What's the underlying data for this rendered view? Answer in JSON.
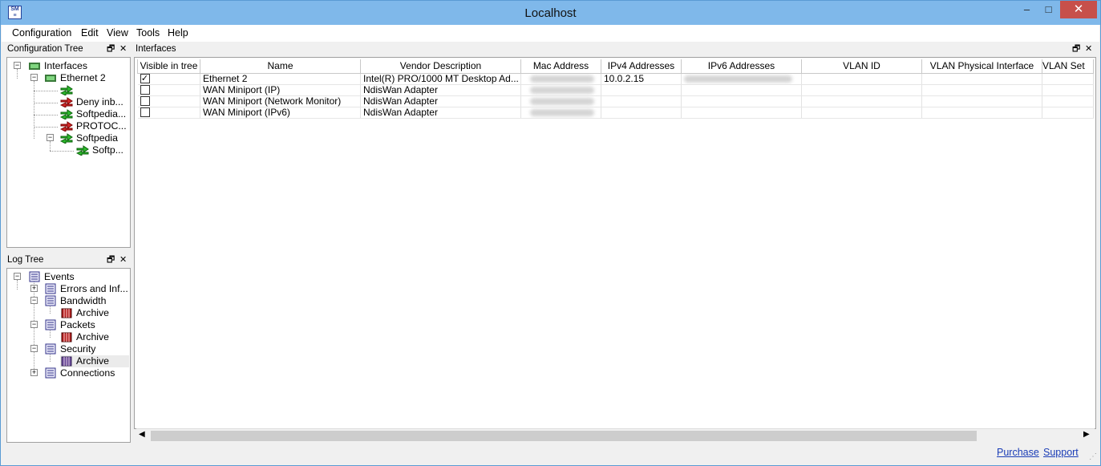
{
  "window": {
    "title": "Localhost",
    "icon": "sm-app-icon",
    "min": "–",
    "max": "□",
    "close": "✕"
  },
  "menu": [
    "Configuration",
    "Edit",
    "View",
    "Tools",
    "Help"
  ],
  "config_tree": {
    "title": "Configuration Tree",
    "nodes": [
      "Interfaces",
      "Ethernet 2",
      "Deny inb...",
      "Softpedia...",
      "PROTOC...",
      "Softpedia",
      "Softp..."
    ]
  },
  "log_tree": {
    "title": "Log Tree",
    "nodes": [
      "Events",
      "Errors and Inf...",
      "Bandwidth",
      "Archive",
      "Packets",
      "Archive",
      "Security",
      "Archive",
      "Connections"
    ]
  },
  "interfaces": {
    "title": "Interfaces",
    "columns": [
      "Visible in tree",
      "Name",
      "Vendor Description",
      "Mac Address",
      "IPv4 Addresses",
      "IPv6 Addresses",
      "VLAN ID",
      "VLAN Physical Interface",
      "VLAN Set"
    ],
    "rows": [
      {
        "visible": true,
        "name": "Ethernet 2",
        "vendor": "Intel(R) PRO/1000 MT Desktop Ad...",
        "ipv4": "10.0.2.15"
      },
      {
        "visible": false,
        "name": "WAN Miniport (IP)",
        "vendor": "NdisWan Adapter",
        "ipv4": ""
      },
      {
        "visible": false,
        "name": "WAN Miniport (Network Monitor)",
        "vendor": "NdisWan Adapter",
        "ipv4": ""
      },
      {
        "visible": false,
        "name": "WAN Miniport (IPv6)",
        "vendor": "NdisWan Adapter",
        "ipv4": ""
      }
    ]
  },
  "status": {
    "purchase": "Purchase",
    "support": "Support"
  },
  "colors": {
    "titlebar": "#7fb8ea",
    "close": "#c7504a",
    "link": "#1a3cb6"
  }
}
